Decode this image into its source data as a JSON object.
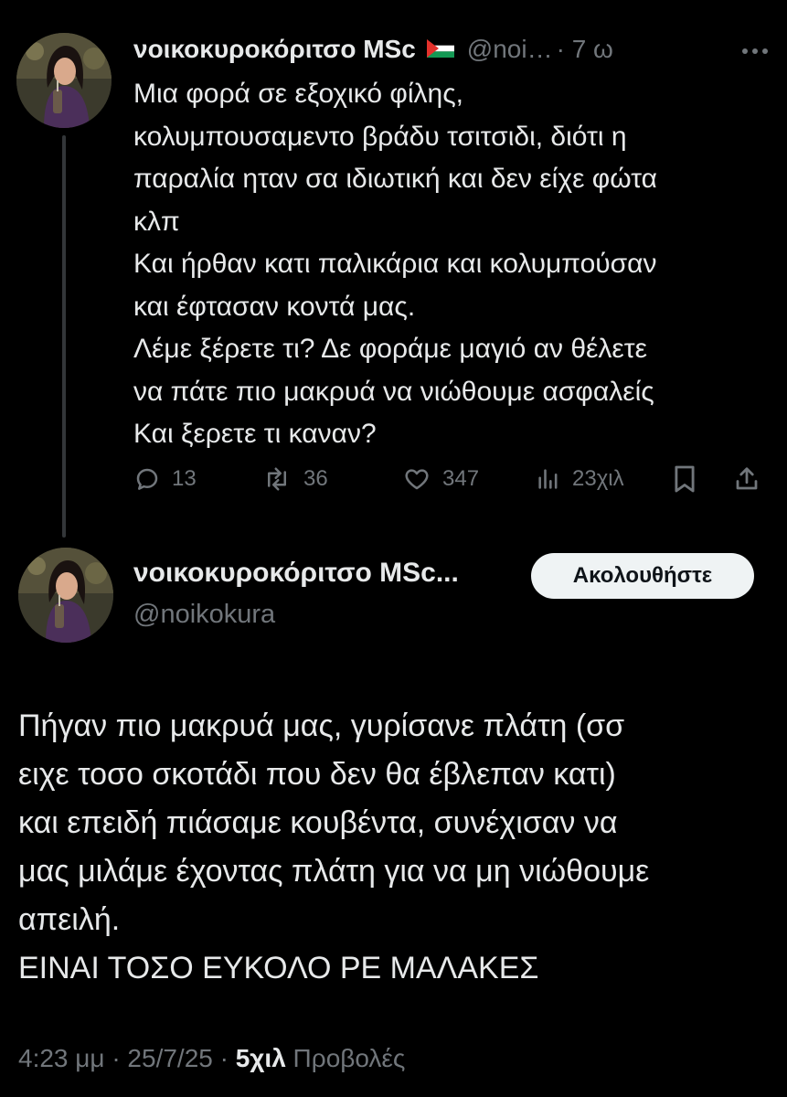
{
  "colors": {
    "background": "#000000",
    "text": "#e7e9ea",
    "muted": "#71767b",
    "button_bg": "#eff3f4",
    "button_text": "#0f1419"
  },
  "tweet1": {
    "display_name": "νοικοκυροκόριτσο MSc",
    "flag_icon": "palestine-flag",
    "handle": "@noi…",
    "time": "· 7 ω",
    "more_icon": "more-icon",
    "lines": [
      "Μια φορά σε εξοχικό φίλης,",
      "κολυμπουσαμεντο βράδυ τσιτσιδι, διότι η",
      "παραλία ηταν σα ιδιωτική και δεν είχε φώτα",
      "κλπ",
      "Και ήρθαν κατι παλικάρια και κολυμπούσαν",
      "και έφτασαν κοντά μας.",
      "Λέμε ξέρετε τι? Δε φοράμε μαγιό αν θέλετε",
      "να πάτε πιο μακρυά να νιώθουμε ασφαλείς",
      "Και ξερετε τι καναν?"
    ],
    "actions": {
      "replies": "13",
      "reposts": "36",
      "likes": "347",
      "views": "23χιλ"
    }
  },
  "tweet2": {
    "display_name": "νοικοκυροκόριτσο MSc...",
    "handle": "@noikokura",
    "follow_label": "Ακολουθήστε",
    "lines": [
      "Πήγαν πιο μακρυά μας, γυρίσανε πλάτη (σσ",
      "ειχε τοσο σκοτάδι που δεν θα έβλεπαν κατι)",
      "και επειδή πιάσαμε κουβέντα, συνέχισαν να",
      "μας μιλάμε έχοντας πλάτη για να μη νιώθουμε",
      "απειλή.",
      "ΕΙΝΑΙ ΤΟΣΟ ΕΥΚΟΛΟ ΡΕ ΜΑΛΑΚΕΣ"
    ],
    "timestamp": "4:23 μμ · 25/7/25 · ",
    "views_count": "5χιλ",
    "views_label": " Προβολές"
  }
}
